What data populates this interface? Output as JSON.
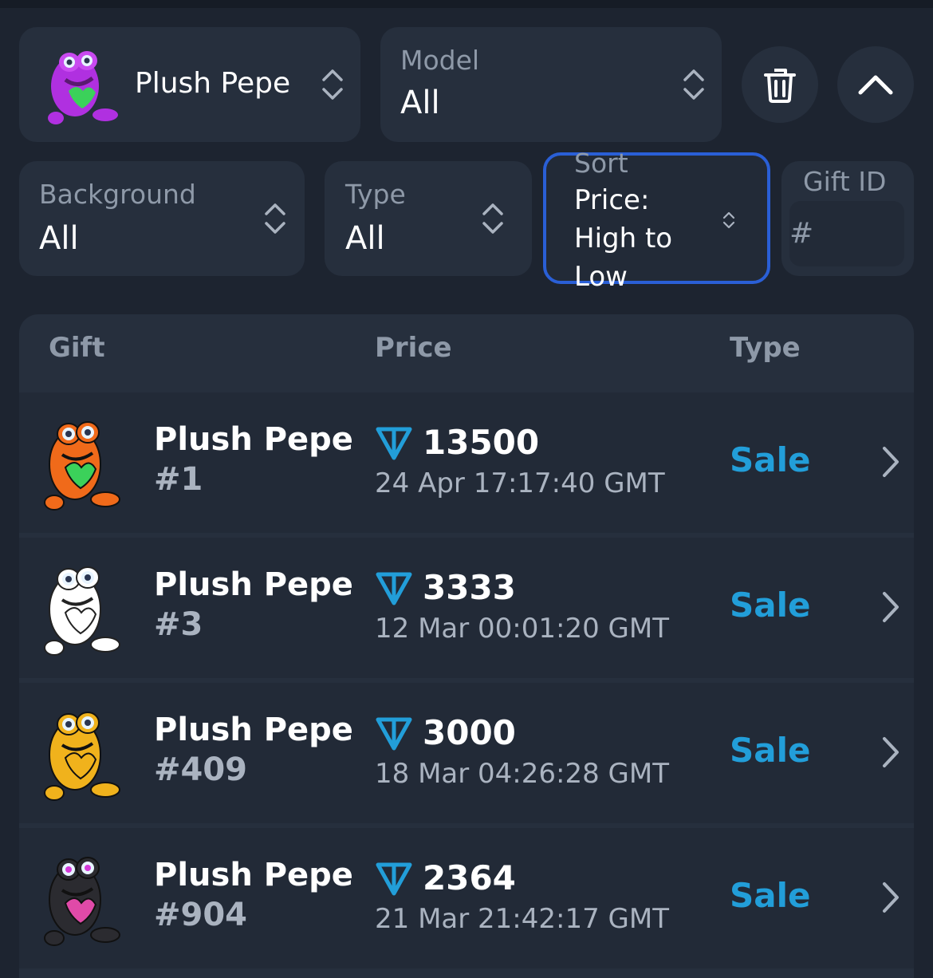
{
  "filters": {
    "collection": {
      "label": "Plush Pepe"
    },
    "model": {
      "label": "Model",
      "value": "All"
    },
    "background": {
      "label": "Background",
      "value": "All"
    },
    "type": {
      "label": "Type",
      "value": "All"
    },
    "sort": {
      "label": "Sort",
      "value_line1": "Price:",
      "value_line2": "High to",
      "value_line3": "Low"
    },
    "gift_id": {
      "label": "Gift ID",
      "placeholder": "#"
    }
  },
  "icons": {
    "delete": "trash-icon",
    "collapse": "chevron-up-icon",
    "currency": "ton-diamond-icon",
    "row_arrow": "chevron-right-icon",
    "select": "updown-chevron-icon"
  },
  "colors": {
    "accent": "#229ed9",
    "focus_border": "#2a5fd6",
    "background": "#1d2430",
    "card": "#262f3d"
  },
  "table": {
    "headers": {
      "gift": "Gift",
      "price": "Price",
      "type": "Type"
    },
    "rows": [
      {
        "name": "Plush Pepe",
        "number": "#1",
        "price": "13500",
        "date": "24 Apr 17:17:40 GMT",
        "type": "Sale",
        "color": "#f06a1a"
      },
      {
        "name": "Plush Pepe",
        "number": "#3",
        "price": "3333",
        "date": "12 Mar 00:01:20 GMT",
        "type": "Sale",
        "color": "#ffffff"
      },
      {
        "name": "Plush Pepe",
        "number": "#409",
        "price": "3000",
        "date": "18 Mar 04:26:28 GMT",
        "type": "Sale",
        "color": "#f0b21c"
      },
      {
        "name": "Plush Pepe",
        "number": "#904",
        "price": "2364",
        "date": "21 Mar 21:42:17 GMT",
        "type": "Sale",
        "color": "#2b2b30"
      }
    ]
  }
}
